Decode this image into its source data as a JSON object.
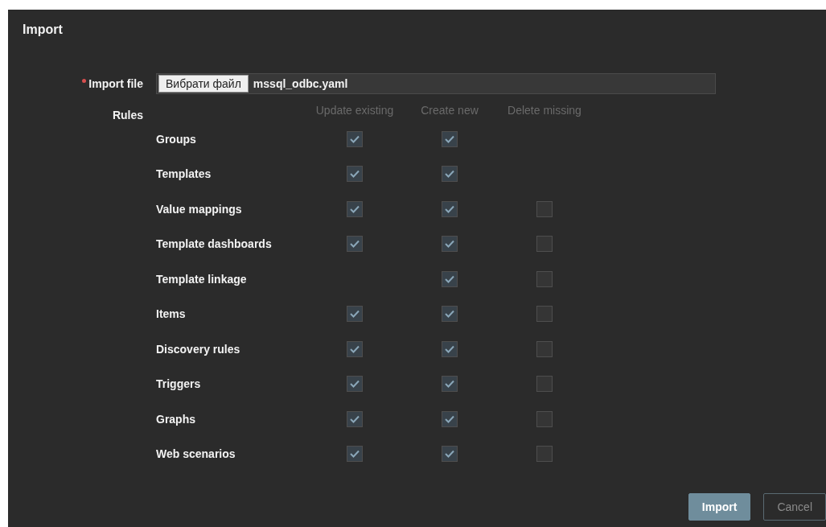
{
  "dialog": {
    "title": "Import"
  },
  "import_file": {
    "label": "Import file",
    "required": true,
    "button": "Вибрати файл",
    "file_name": "mssql_odbc.yaml"
  },
  "rules": {
    "label": "Rules",
    "columns": [
      "Update existing",
      "Create new",
      "Delete missing"
    ],
    "items": [
      {
        "label": "Groups",
        "update_existing": true,
        "create_new": true
      },
      {
        "label": "Templates",
        "update_existing": true,
        "create_new": true
      },
      {
        "label": "Value mappings",
        "update_existing": true,
        "create_new": true,
        "delete_missing": false
      },
      {
        "label": "Template dashboards",
        "update_existing": true,
        "create_new": true,
        "delete_missing": false
      },
      {
        "label": "Template linkage",
        "create_new": true,
        "delete_missing": false
      },
      {
        "label": "Items",
        "update_existing": true,
        "create_new": true,
        "delete_missing": false
      },
      {
        "label": "Discovery rules",
        "update_existing": true,
        "create_new": true,
        "delete_missing": false
      },
      {
        "label": "Triggers",
        "update_existing": true,
        "create_new": true,
        "delete_missing": false
      },
      {
        "label": "Graphs",
        "update_existing": true,
        "create_new": true,
        "delete_missing": false
      },
      {
        "label": "Web scenarios",
        "update_existing": true,
        "create_new": true,
        "delete_missing": false
      }
    ]
  },
  "buttons": [
    {
      "label": "Import",
      "kind": "primary"
    },
    {
      "label": "Cancel",
      "kind": "secondary"
    }
  ]
}
